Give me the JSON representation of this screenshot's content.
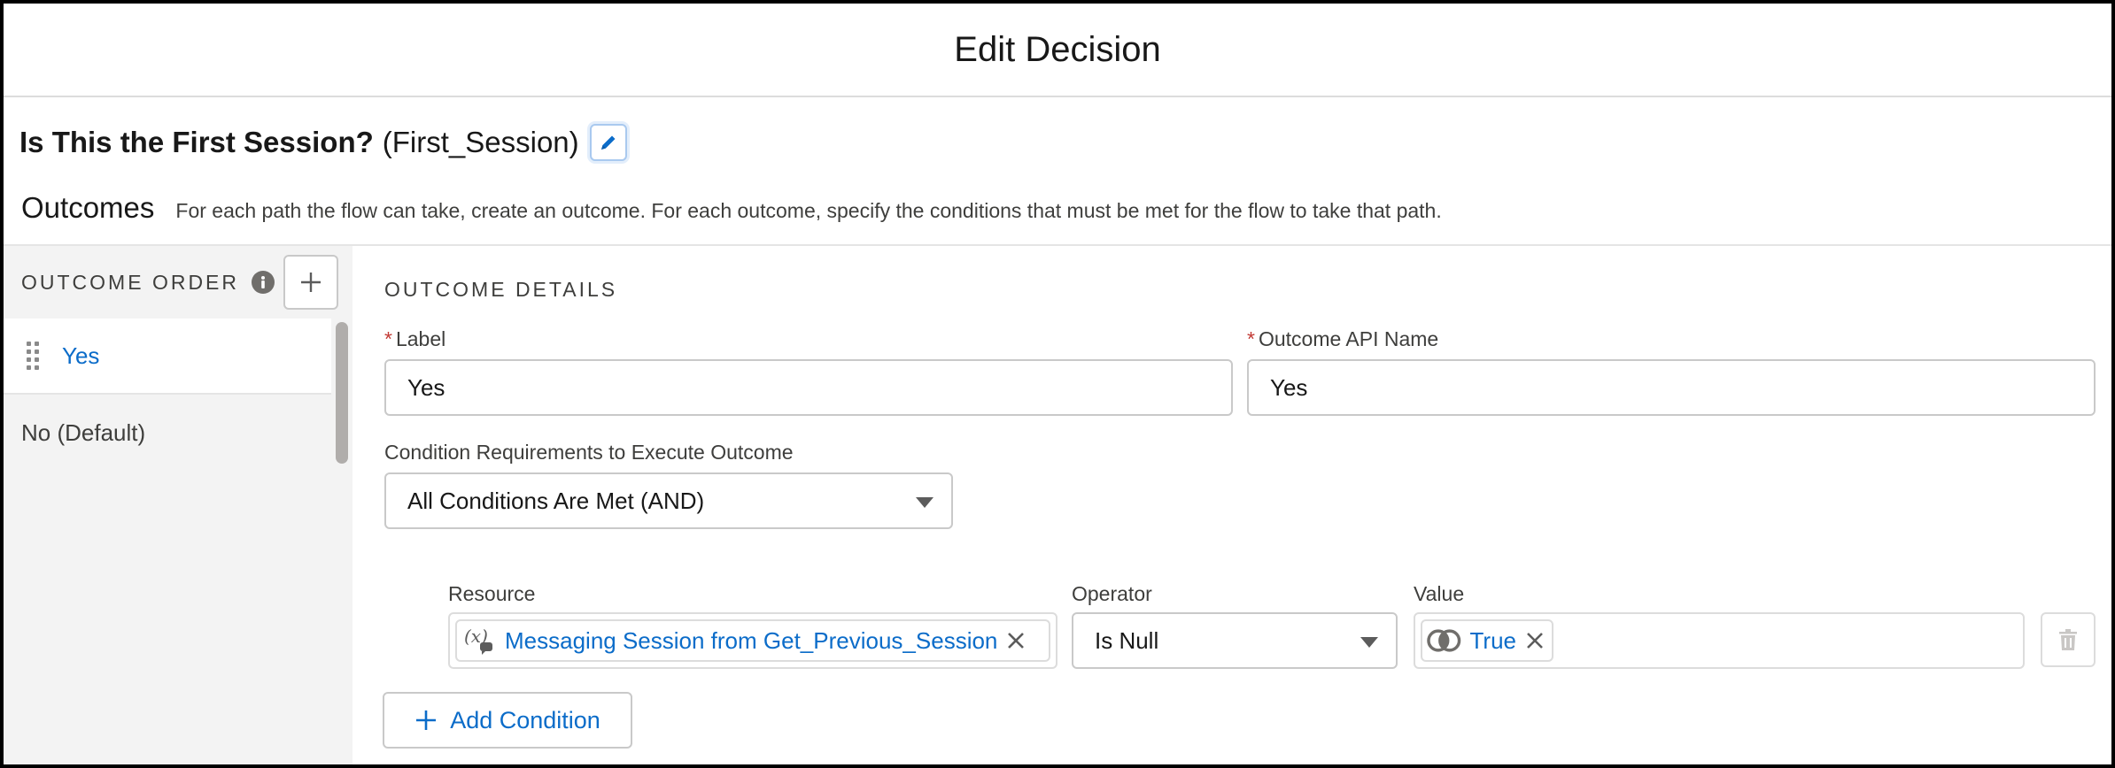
{
  "modal": {
    "title": "Edit Decision"
  },
  "element": {
    "label": "Is This the First Session?",
    "api_name": "(First_Session)"
  },
  "outcomes": {
    "title": "Outcomes",
    "description": "For each path the flow can take, create an outcome. For each outcome, specify the conditions that must be met for the flow to take that path."
  },
  "sidebar": {
    "title": "OUTCOME ORDER",
    "items": [
      {
        "label": "Yes",
        "selected": true
      },
      {
        "label": "No (Default)",
        "selected": false
      }
    ]
  },
  "details": {
    "section_title": "OUTCOME DETAILS",
    "label_field": {
      "label": "Label",
      "value": "Yes"
    },
    "api_field": {
      "label": "Outcome API Name",
      "value": "Yes"
    },
    "requirements": {
      "label": "Condition Requirements to Execute Outcome",
      "value": "All Conditions Are Met (AND)"
    },
    "condition": {
      "resource_label": "Resource",
      "resource_value": "Messaging Session from Get_Previous_Session",
      "operator_label": "Operator",
      "operator_value": "Is Null",
      "value_label": "Value",
      "value_value": "True"
    },
    "add_condition": "Add Condition"
  },
  "colors": {
    "link": "#0b6cc9",
    "required": "#c23934"
  },
  "icons": [
    "pencil-icon",
    "info-icon",
    "plus-icon",
    "drag-handle-icon",
    "variable-icon",
    "boolean-icon",
    "close-icon",
    "trash-icon",
    "caret-down-icon"
  ]
}
